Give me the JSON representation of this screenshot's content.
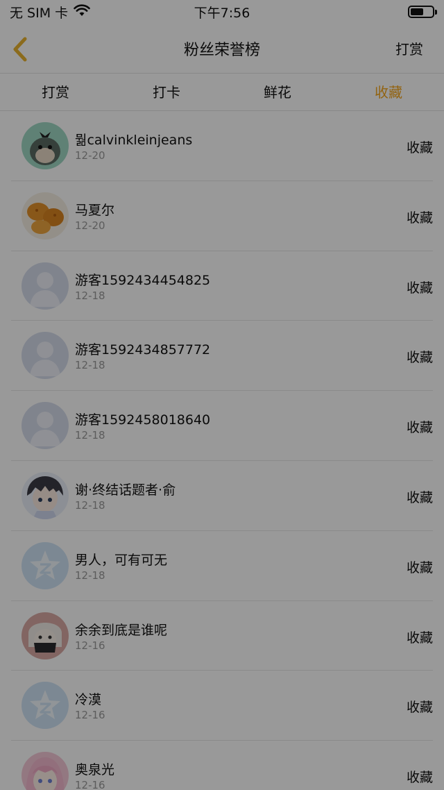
{
  "status_bar": {
    "carrier": "无 SIM 卡",
    "time": "下午7:56"
  },
  "nav": {
    "title": "粉丝荣誉榜",
    "right_action": "打赏"
  },
  "tabs": [
    {
      "label": "打赏",
      "active": false
    },
    {
      "label": "打卡",
      "active": false
    },
    {
      "label": "鲜花",
      "active": false
    },
    {
      "label": "收藏",
      "active": true
    }
  ],
  "colors": {
    "accent": "#f4a51c",
    "overlay": "rgba(0,0,0,0.4)"
  },
  "rows": [
    {
      "name": "뭚calvinkleinjeans",
      "date": "12-20",
      "action": "收藏",
      "avatar": "monkey-avatar"
    },
    {
      "name": "马夏尔",
      "date": "12-20",
      "action": "收藏",
      "avatar": "food-avatar"
    },
    {
      "name": "游客1592434454825",
      "date": "12-18",
      "action": "收藏",
      "avatar": "default-person-avatar"
    },
    {
      "name": "游客1592434857772",
      "date": "12-18",
      "action": "收藏",
      "avatar": "default-person-avatar"
    },
    {
      "name": "游客1592458018640",
      "date": "12-18",
      "action": "收藏",
      "avatar": "default-person-avatar"
    },
    {
      "name": "谢·终结话题者·俞",
      "date": "12-18",
      "action": "收藏",
      "avatar": "anime-boy-avatar"
    },
    {
      "name": "男人，可有可无",
      "date": "12-18",
      "action": "收藏",
      "avatar": "qzone-star-avatar"
    },
    {
      "name": "余余到底是谁呢",
      "date": "12-16",
      "action": "收藏",
      "avatar": "anime-dark-avatar"
    },
    {
      "name": "冷漠",
      "date": "12-16",
      "action": "收藏",
      "avatar": "qzone-star-avatar"
    },
    {
      "name": "奥泉光",
      "date": "12-16",
      "action": "收藏",
      "avatar": "anime-girl-avatar"
    }
  ]
}
